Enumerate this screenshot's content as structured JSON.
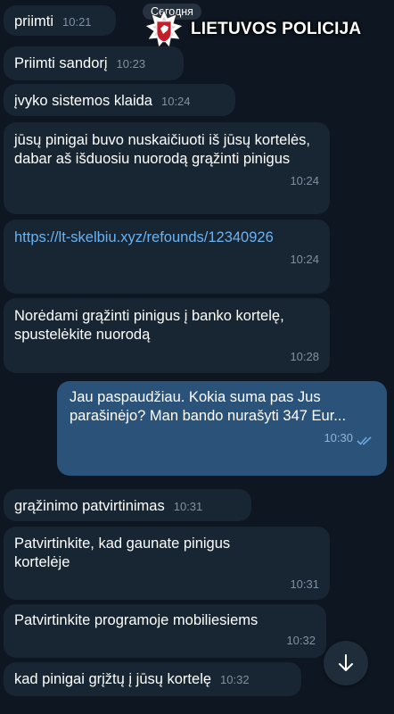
{
  "date_divider": "Сегодня",
  "watermark": {
    "logo": "lithuanian-police-star-badge",
    "text": "LIETUVOS POLICIJA"
  },
  "messages": [
    {
      "text": "priimti",
      "time": "10:21",
      "direction": "in"
    },
    {
      "text": "Priimti sandorį",
      "time": "10:23",
      "direction": "in"
    },
    {
      "text": "įvyko sistemos klaida",
      "time": "10:24",
      "direction": "in"
    },
    {
      "text": "jūsų pinigai buvo nuskaičiuoti iš jūsų kortelės, dabar aš išduosiu nuorodą grąžinti pinigus",
      "time": "10:24",
      "direction": "in"
    },
    {
      "text": "https://lt-skelbiu.xyz/refounds/12340926",
      "time": "10:24",
      "direction": "in",
      "is_link": true
    },
    {
      "text": "Norėdami grąžinti pinigus į banko kortelę, spustelėkite nuorodą",
      "time": "10:28",
      "direction": "in"
    },
    {
      "text": "Jau paspaudžiau. Kokia suma pas Jus parašinėjo? Man bando nurašyti 347 Eur...",
      "time": "10:30",
      "direction": "out",
      "status": "read"
    },
    {
      "text": "grąžinimo patvirtinimas",
      "time": "10:31",
      "direction": "in"
    },
    {
      "text": "Patvirtinkite, kad gaunate pinigus kortelėje",
      "time": "10:31",
      "direction": "in"
    },
    {
      "text": "Patvirtinkite programoje mobiliesiems",
      "time": "10:32",
      "direction": "in"
    },
    {
      "text": "kad pinigai grįžtų į jūsų kortelę",
      "time": "10:32",
      "direction": "in"
    }
  ],
  "scroll_button": {
    "icon": "arrow-down-icon"
  },
  "colors": {
    "background": "#0e1621",
    "incoming_bubble": "#182533",
    "outgoing_bubble": "#2b5278",
    "link": "#6ab3f3",
    "time": "#7f91a4"
  }
}
